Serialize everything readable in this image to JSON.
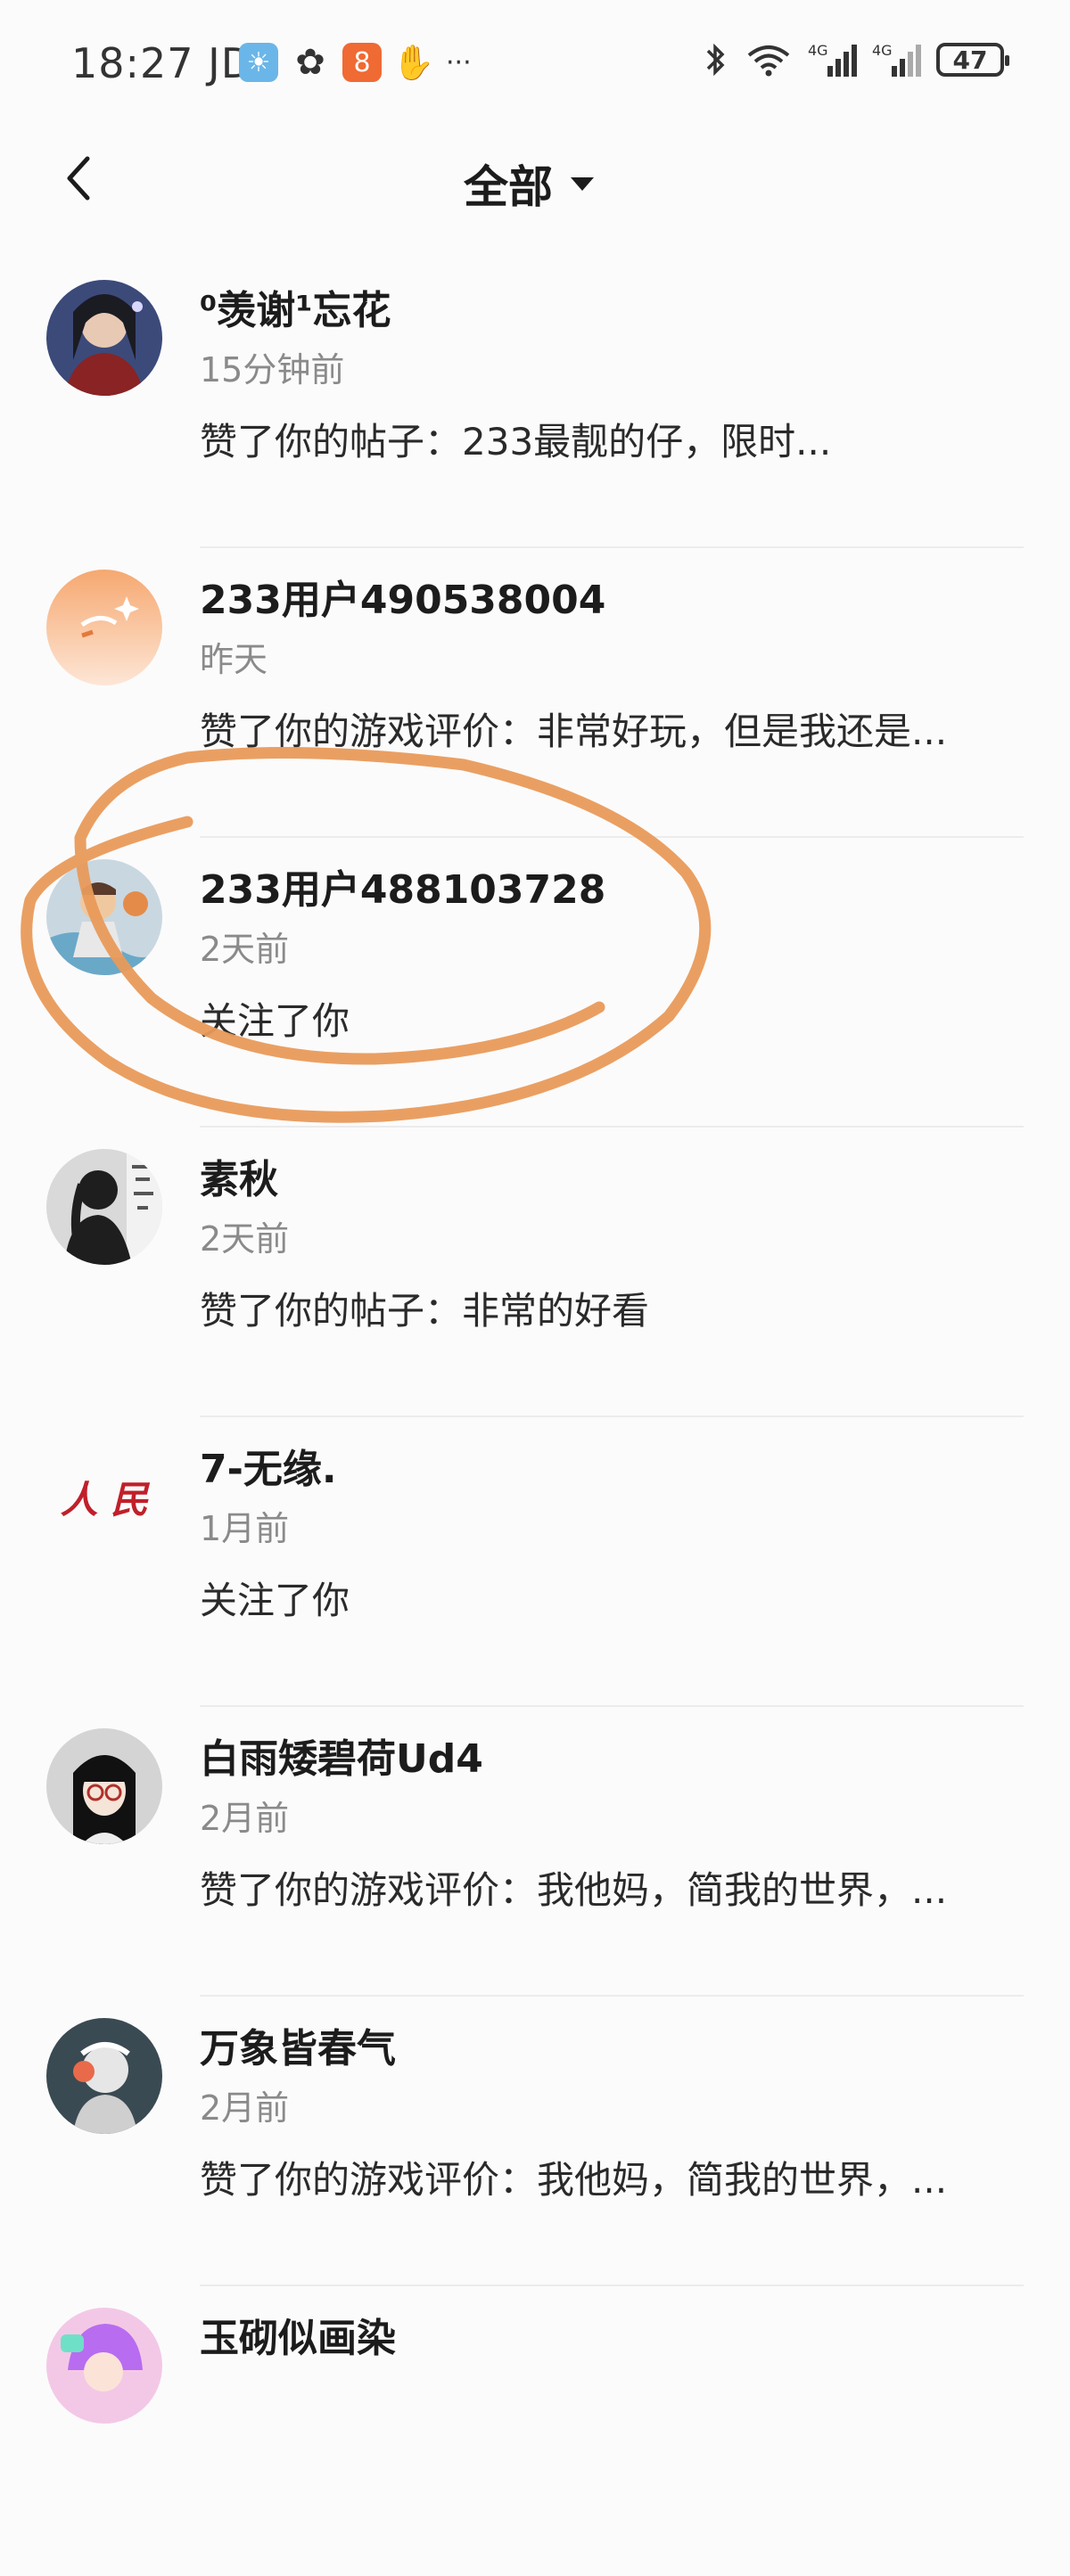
{
  "status_bar": {
    "time": "18:27 JD",
    "more": "···",
    "battery": "47"
  },
  "header": {
    "title": "全部"
  },
  "notifications": [
    {
      "name": "⁰羡谢¹忘花",
      "time": "15分钟前",
      "message": "赞了你的帖子：233最靓的仔，限时..."
    },
    {
      "name": "233用户490538004",
      "time": "昨天",
      "message": "赞了你的游戏评价：非常好玩，但是我还是..."
    },
    {
      "name": "233用户488103728",
      "time": "2天前",
      "message": "关注了你"
    },
    {
      "name": "素秋",
      "time": "2天前",
      "message": "赞了你的帖子：非常的好看"
    },
    {
      "name": "7-无缘.",
      "time": "1月前",
      "message": "关注了你",
      "avatar_text": "人 民"
    },
    {
      "name": "白雨矮碧荷Ud4",
      "time": "2月前",
      "message": "赞了你的游戏评价：我他妈，简我的世界，..."
    },
    {
      "name": "万象皆春气",
      "time": "2月前",
      "message": "赞了你的游戏评价：我他妈，简我的世界，..."
    },
    {
      "name": "玉砌似画染",
      "time": "",
      "message": ""
    }
  ],
  "colors": {
    "annotation_circle": "#e99a5a",
    "divider": "#ececec",
    "secondary_text": "#8a8a8a"
  }
}
